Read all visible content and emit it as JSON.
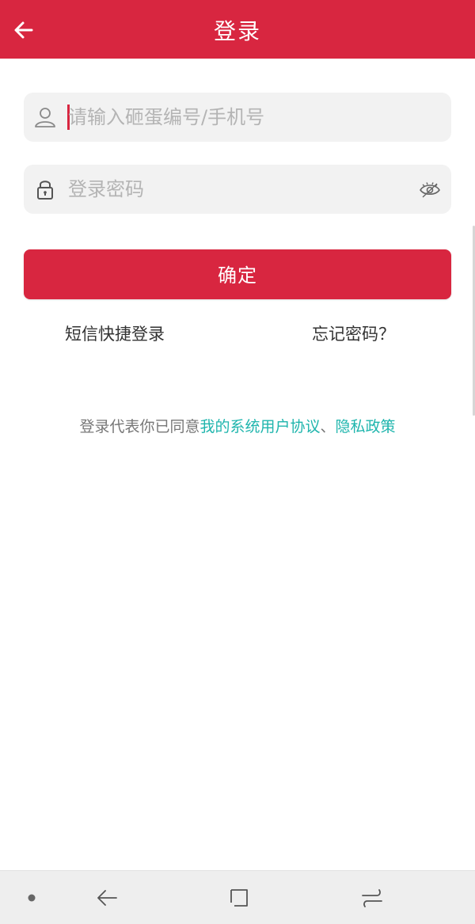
{
  "header": {
    "title": "登录",
    "back_icon": "arrow-left-icon",
    "bg_color": "#d82640"
  },
  "form": {
    "username": {
      "placeholder": "请输入砸蛋编号/手机号",
      "value": "",
      "icon": "user-icon"
    },
    "password": {
      "placeholder": "登录密码",
      "value": "",
      "icon": "lock-icon",
      "toggle_icon": "eye-closed-icon"
    },
    "confirm_label": "确定"
  },
  "links": {
    "sms_login": "短信快捷登录",
    "forgot_password": "忘记密码？"
  },
  "agreement": {
    "prefix": "登录代表你已同意",
    "user_agreement": "我的系统用户协议",
    "separator": "、",
    "privacy_policy": "隐私政策",
    "link_color": "#1fb5ad"
  },
  "system_nav": {
    "items": [
      "dot-icon",
      "back-icon",
      "recents-icon",
      "switch-icon"
    ]
  }
}
